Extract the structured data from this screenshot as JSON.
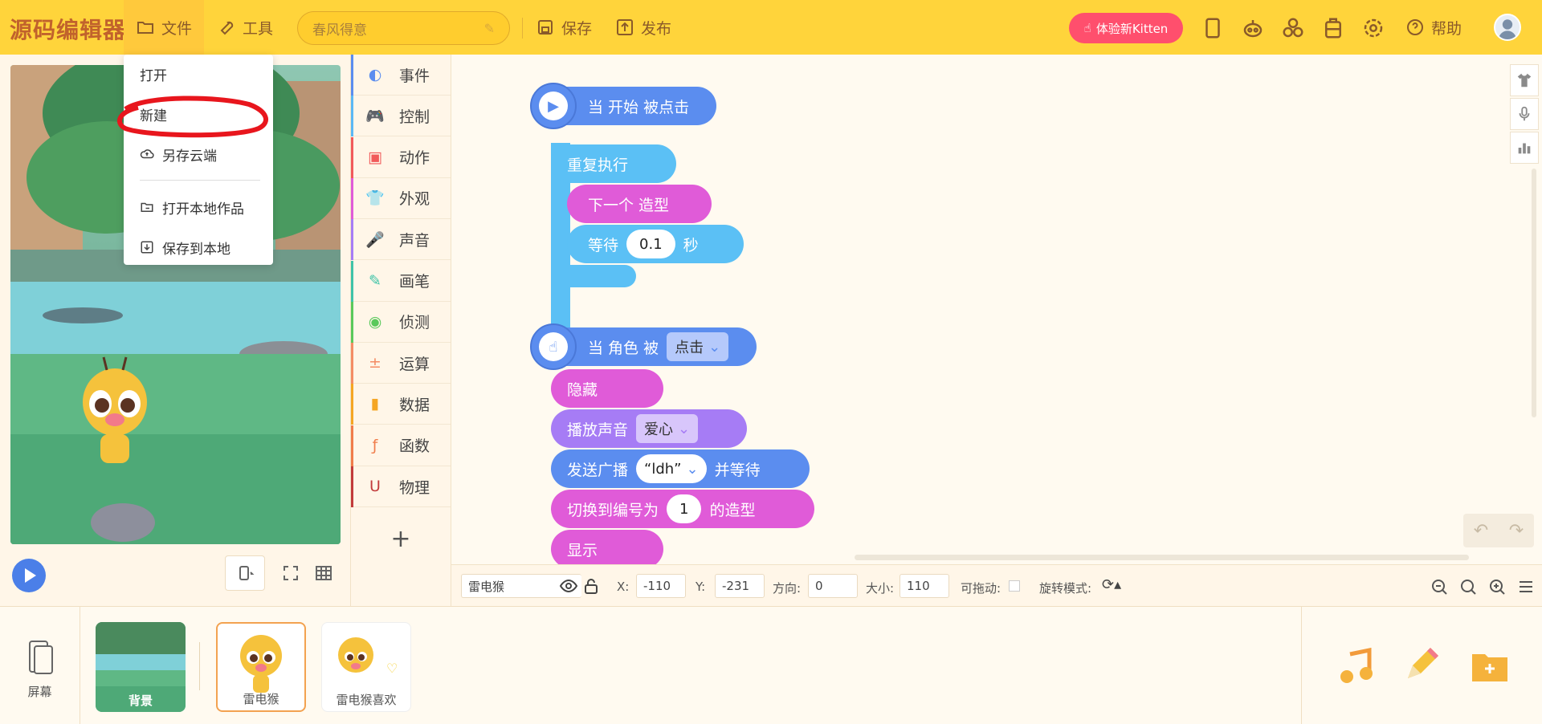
{
  "app": {
    "logo": "源码编辑器",
    "menu_file": "文件",
    "menu_tools": "工具",
    "project_title_placeholder": "春风得意",
    "save": "保存",
    "publish": "发布",
    "kitten_button": "体验新Kitten",
    "help": "帮助"
  },
  "file_menu": {
    "items": [
      "打开",
      "新建",
      "另存云端",
      "打开本地作品",
      "保存到本地"
    ]
  },
  "categories": [
    {
      "label": "事件",
      "color": "#5b8def"
    },
    {
      "label": "控制",
      "color": "#5bb8f5"
    },
    {
      "label": "动作",
      "color": "#f15a5a"
    },
    {
      "label": "外观",
      "color": "#e05bd8"
    },
    {
      "label": "声音",
      "color": "#a67cf5"
    },
    {
      "label": "画笔",
      "color": "#3fc3a8"
    },
    {
      "label": "侦测",
      "color": "#5ac95b"
    },
    {
      "label": "运算",
      "color": "#f48c65"
    },
    {
      "label": "数据",
      "color": "#f5a623"
    },
    {
      "label": "函数",
      "color": "#f07c4a"
    },
    {
      "label": "物理",
      "color": "#c23b3b"
    }
  ],
  "script1": {
    "hat": "当 开始 被点击",
    "repeat": "重复执行",
    "next_costume": "下一个 造型",
    "wait_label": "等待",
    "wait_value": "0.1",
    "wait_unit": "秒"
  },
  "script2": {
    "hat_prefix": "当 角色 被",
    "hat_dropdown": "点击",
    "hide": "隐藏",
    "play_sound": "播放声音",
    "sound_dropdown": "爱心",
    "broadcast": "发送广播",
    "broadcast_value": "“ldh”",
    "broadcast_suffix": "并等待",
    "switch_costume": "切换到编号为",
    "costume_index": "1",
    "costume_suffix": "的造型",
    "show": "显示"
  },
  "properties": {
    "sprite_name": "雷电猴",
    "x_label": "X:",
    "x_value": "-110",
    "y_label": "Y:",
    "y_value": "-231",
    "dir_label": "方向:",
    "dir_value": "0",
    "size_label": "大小:",
    "size_value": "110",
    "draggable_label": "可拖动:",
    "rotation_label": "旋转模式:"
  },
  "bottom": {
    "screen": "屏幕",
    "sprites": [
      "背景",
      "雷电猴",
      "雷电猴喜欢"
    ]
  }
}
